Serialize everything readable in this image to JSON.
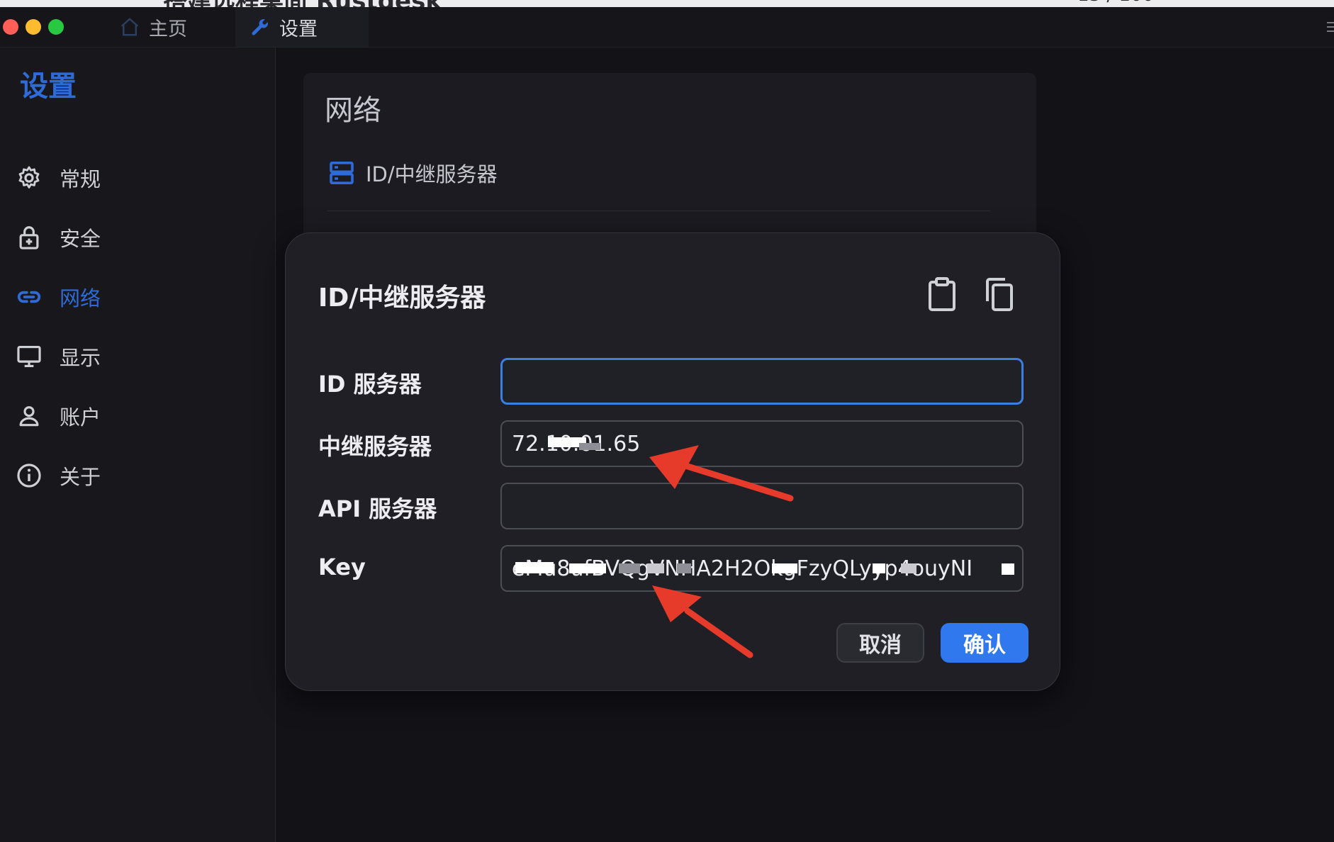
{
  "window": {
    "tabs": [
      {
        "label": "主页",
        "icon": "home-icon"
      },
      {
        "label": "设置",
        "icon": "wrench-icon"
      }
    ],
    "traffic_lights": [
      "#ff5f57",
      "#febc2e",
      "#28c840"
    ]
  },
  "sidebar": {
    "title": "设置",
    "items": [
      {
        "label": "常规",
        "icon": "gear-icon"
      },
      {
        "label": "安全",
        "icon": "lock-icon"
      },
      {
        "label": "网络",
        "icon": "link-icon",
        "active": true
      },
      {
        "label": "显示",
        "icon": "monitor-icon"
      },
      {
        "label": "账户",
        "icon": "person-icon"
      },
      {
        "label": "关于",
        "icon": "info-icon"
      }
    ]
  },
  "panel": {
    "title": "网络",
    "row_label": "ID/中继服务器",
    "row_icon": "server-icon"
  },
  "dialog": {
    "title": "ID/中继服务器",
    "actions": {
      "paste_icon": "clipboard-icon",
      "copy_icon": "copy-icon"
    },
    "fields": [
      {
        "label": "ID 服务器",
        "value": ""
      },
      {
        "label": "中继服务器",
        "value": "72.10.01.65"
      },
      {
        "label": "API 服务器",
        "value": ""
      },
      {
        "label": "Key",
        "value": "eMu8ufBVQgVNHA2H2OkgFzyQLyyp4ouyNI"
      }
    ],
    "cancel_label": "取消",
    "confirm_label": "确认"
  },
  "colors": {
    "accent": "#2f78ee",
    "sidebar_active": "#2f6bd8",
    "annotation_arrow": "#e63a2a"
  }
}
